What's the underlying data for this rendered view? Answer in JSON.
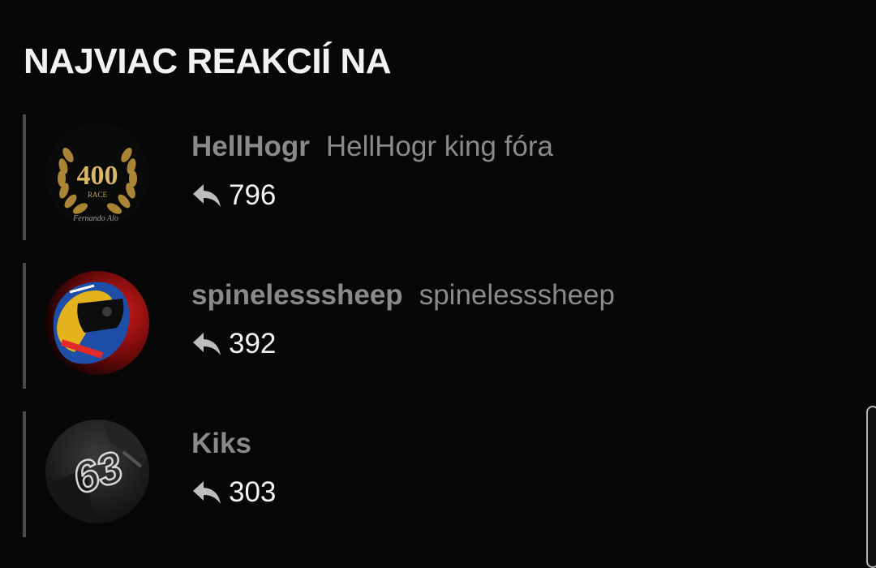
{
  "section": {
    "title": "NAJVIAC REAKCIÍ NA"
  },
  "users": [
    {
      "username": "HellHogr",
      "user_title": "HellHogr king fóra",
      "reactions": "796",
      "avatar": {
        "icon": "laurel-400-race-badge",
        "text_big": "400",
        "text_small": "RACE",
        "caption": "Fernando Alo"
      }
    },
    {
      "username": "spinelesssheep",
      "user_title": "spinelesssheep",
      "reactions": "392",
      "avatar": {
        "icon": "racing-helmet-avatar"
      }
    },
    {
      "username": "Kiks",
      "user_title": "",
      "reactions": "303",
      "avatar": {
        "icon": "number-63-avatar",
        "text_big": "63"
      }
    }
  ],
  "icons": {
    "reactions": "reply-arrow-icon"
  },
  "colors": {
    "background": "#070707",
    "title": "#f2f2f2",
    "username": "#8a8a8a",
    "count": "#f4f4f4",
    "divider": "#4a4a4a",
    "gold": "#b8923f",
    "helmet_red": "#c0161c",
    "helmet_blue": "#1d4ea8"
  }
}
